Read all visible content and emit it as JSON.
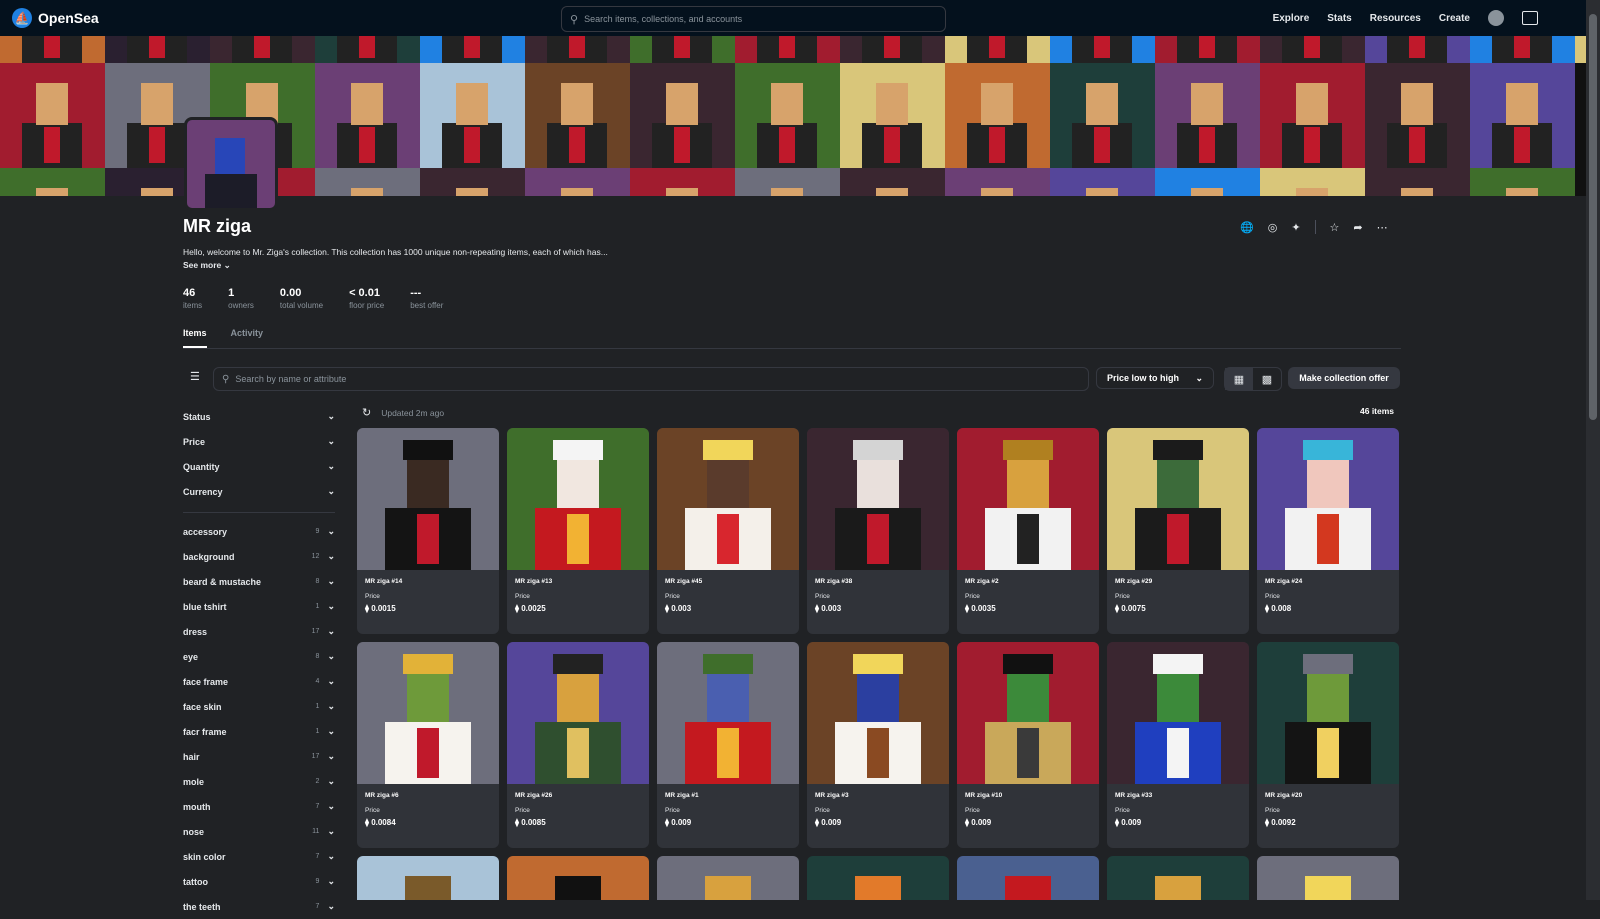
{
  "brand": {
    "name": "OpenSea",
    "logo_icon": "sailboat-icon"
  },
  "search": {
    "placeholder": "Search items, collections, and accounts"
  },
  "nav": {
    "explore": "Explore",
    "stats": "Stats",
    "resources": "Resources",
    "create": "Create"
  },
  "collection": {
    "title": "MR ziga",
    "description": "Hello, welcome to Mr. Ziga's collection. This collection has 1000 unique non-repeating items, each of which has...",
    "see_more": "See more",
    "stats": [
      {
        "value": "46",
        "label": "items"
      },
      {
        "value": "1",
        "label": "owners"
      },
      {
        "value": "0.00",
        "label": "total volume"
      },
      {
        "value": "< 0.01",
        "label": "floor price"
      },
      {
        "value": "---",
        "label": "best offer"
      }
    ]
  },
  "tabs": [
    {
      "label": "Items"
    },
    {
      "label": "Activity"
    }
  ],
  "toolbar": {
    "item_search_placeholder": "Search by name or attribute",
    "sort_label": "Price low to high",
    "offer_label": "Make collection offer"
  },
  "status": {
    "updated": "Updated 2m ago",
    "count": "46 items"
  },
  "filters": [
    {
      "label": "Status"
    },
    {
      "label": "Price"
    },
    {
      "label": "Quantity"
    },
    {
      "label": "Currency"
    }
  ],
  "traits": [
    {
      "label": "accessory",
      "count": "9"
    },
    {
      "label": "background",
      "count": "12"
    },
    {
      "label": "beard & mustache",
      "count": "8"
    },
    {
      "label": "blue tshirt",
      "count": "1"
    },
    {
      "label": "dress",
      "count": "17"
    },
    {
      "label": "eye",
      "count": "8"
    },
    {
      "label": "face frame",
      "count": "4"
    },
    {
      "label": "face skin",
      "count": "1"
    },
    {
      "label": "facr frame",
      "count": "1"
    },
    {
      "label": "hair",
      "count": "17"
    },
    {
      "label": "mole",
      "count": "2"
    },
    {
      "label": "mouth",
      "count": "7"
    },
    {
      "label": "nose",
      "count": "11"
    },
    {
      "label": "skin color",
      "count": "7"
    },
    {
      "label": "tattoo",
      "count": "9"
    },
    {
      "label": "the teeth",
      "count": "7"
    }
  ],
  "price_label": "Price",
  "items": [
    {
      "name": "MR ziga #14",
      "price": "0.0015",
      "bg": "#6d6e7c",
      "skin": "#3a2a22",
      "hair": "#111111",
      "body": "#141414",
      "sash": "#c0192b"
    },
    {
      "name": "MR ziga #13",
      "price": "0.0025",
      "bg": "#3f6e2b",
      "skin": "#f1e7e0",
      "hair": "#f4f4f4",
      "body": "#c4191f",
      "sash": "#f2b233"
    },
    {
      "name": "MR ziga #45",
      "price": "0.003",
      "bg": "#6b4326",
      "skin": "#5a3b2c",
      "hair": "#f1d65a",
      "body": "#f4f0ea",
      "sash": "#d8262e"
    },
    {
      "name": "MR ziga #38",
      "price": "0.003",
      "bg": "#3a2630",
      "skin": "#e9e0dc",
      "hair": "#d4d4d4",
      "body": "#1a1a1a",
      "sash": "#c0192b"
    },
    {
      "name": "MR ziga #2",
      "price": "0.0035",
      "bg": "#a11c2f",
      "skin": "#d8a13e",
      "hair": "#b08020",
      "body": "#f2f2f2",
      "sash": "#222222"
    },
    {
      "name": "MR ziga #29",
      "price": "0.0075",
      "bg": "#d9c67a",
      "skin": "#3c6b3a",
      "hair": "#1b1b1b",
      "body": "#1b1b1b",
      "sash": "#c0192b"
    },
    {
      "name": "MR ziga #24",
      "price": "0.008",
      "bg": "#55469a",
      "skin": "#f0c7bd",
      "hair": "#38b5d9",
      "body": "#f2f2f2",
      "sash": "#d3381f"
    },
    {
      "name": "MR ziga #6",
      "price": "0.0084",
      "bg": "#6d6e7c",
      "skin": "#6e9a3a",
      "hair": "#e2b238",
      "body": "#f6f3ee",
      "sash": "#c0192b"
    },
    {
      "name": "MR ziga #26",
      "price": "0.0085",
      "bg": "#55469a",
      "skin": "#d8a13e",
      "hair": "#222222",
      "body": "#2f4f2f",
      "sash": "#e0c060"
    },
    {
      "name": "MR ziga #1",
      "price": "0.009",
      "bg": "#6d6e7c",
      "skin": "#4a5fb0",
      "hair": "#3f6e2b",
      "body": "#c4191f",
      "sash": "#f2b233"
    },
    {
      "name": "MR ziga #3",
      "price": "0.009",
      "bg": "#6b4326",
      "skin": "#2b3fa0",
      "hair": "#f1d65a",
      "body": "#f6f3ee",
      "sash": "#8a4a22"
    },
    {
      "name": "MR ziga #10",
      "price": "0.009",
      "bg": "#a11c2f",
      "skin": "#3c8a3a",
      "hair": "#111111",
      "body": "#c9a85a",
      "sash": "#3a3a3a"
    },
    {
      "name": "MR ziga #33",
      "price": "0.009",
      "bg": "#3a2630",
      "skin": "#3c8a3a",
      "hair": "#f4f4f4",
      "body": "#1f3fbf",
      "sash": "#f4f4f4"
    },
    {
      "name": "MR ziga #20",
      "price": "0.0092",
      "bg": "#1e3e3a",
      "skin": "#6e9a3a",
      "hair": "#6d6e7c",
      "body": "#141414",
      "sash": "#f0d060"
    }
  ],
  "partial_row": [
    {
      "bg": "#a9c3d8",
      "fg": "#7a5a2a"
    },
    {
      "bg": "#c06a30",
      "fg": "#111111"
    },
    {
      "bg": "#6d6e7c",
      "fg": "#d8a13e"
    },
    {
      "bg": "#1e3e3a",
      "fg": "#e27a2a"
    },
    {
      "bg": "#4a6090",
      "fg": "#c4191f"
    },
    {
      "bg": "#1e3e3a",
      "fg": "#d8a13e"
    },
    {
      "bg": "#6d6e7c",
      "fg": "#f1d65a"
    }
  ],
  "banner": {
    "row1": [
      "#c06a30",
      "#2a2030",
      "#3a2630",
      "#1e3e3a",
      "#2081e2",
      "#3a2630",
      "#3f6e2b",
      "#a11c2f",
      "#3a2630",
      "#d9c67a",
      "#2081e2",
      "#a11c2f",
      "#3a2630",
      "#55469a",
      "#2081e2",
      "#d9c67a"
    ],
    "row2": [
      "#a11c2f",
      "#6d6e7c",
      "#3f6e2b",
      "#6b3f75",
      "#a9c3d8",
      "#6b4326",
      "#3a2630",
      "#3f6e2b",
      "#d9c67a",
      "#c06a30",
      "#1e3e3a",
      "#6b3f75",
      "#a11c2f",
      "#3a2630",
      "#55469a"
    ],
    "row3": [
      "#3f6e2b",
      "#2a2030",
      "#a11c2f",
      "#6d6e7c",
      "#3a2630",
      "#6b3f75",
      "#a11c2f",
      "#6d6e7c",
      "#3a2630",
      "#6b3f75",
      "#55469a",
      "#2081e2",
      "#d9c67a",
      "#3a2630",
      "#3f6e2b"
    ]
  },
  "colors": {
    "bg": "#202225",
    "topbar": "#04111d",
    "accent": "#2081e2"
  }
}
